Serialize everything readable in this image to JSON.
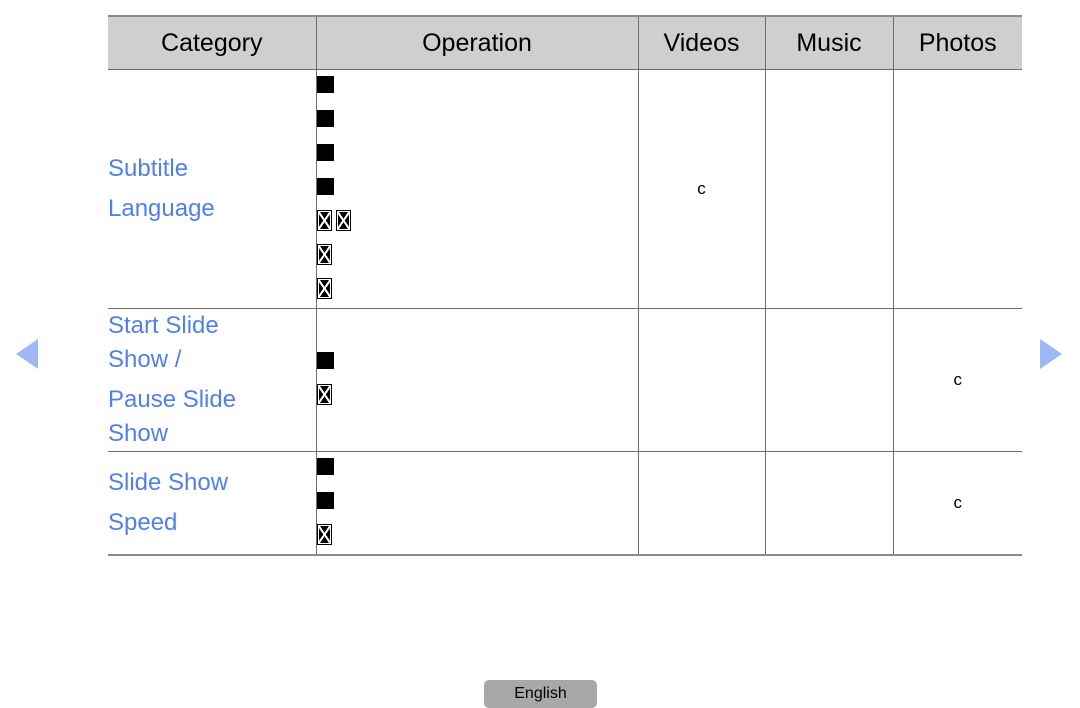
{
  "nav": {
    "prev_label": "previous page",
    "next_label": "next page",
    "arrow_color": "#9db8f5"
  },
  "table": {
    "headers": [
      "Category",
      "Operation",
      "Videos",
      "Music",
      "Photos"
    ],
    "header_bg": "#cfcfcf",
    "category_color": "#4f80ee",
    "support_mark": "c",
    "rows": [
      {
        "category": [
          "Subtitle",
          "Language"
        ],
        "operation_glyph_lines": [
          [
            "filled"
          ],
          [
            "filled"
          ],
          [
            "filled"
          ],
          [
            "filled"
          ],
          [
            "box",
            "box"
          ],
          [
            "box"
          ],
          [
            "box"
          ]
        ],
        "videos": "c",
        "music": "",
        "photos": ""
      },
      {
        "category": [
          "Start Slide\nShow /",
          "Pause Slide\nShow"
        ],
        "operation_glyph_lines": [
          [
            "filled"
          ],
          [
            "box"
          ]
        ],
        "videos": "",
        "music": "",
        "photos": "c"
      },
      {
        "category": [
          "Slide Show",
          "Speed"
        ],
        "operation_glyph_lines": [
          [
            "filled"
          ],
          [
            "filled"
          ],
          [
            "box"
          ]
        ],
        "videos": "",
        "music": "",
        "photos": "c"
      }
    ]
  },
  "footer": {
    "language_label": "English"
  }
}
